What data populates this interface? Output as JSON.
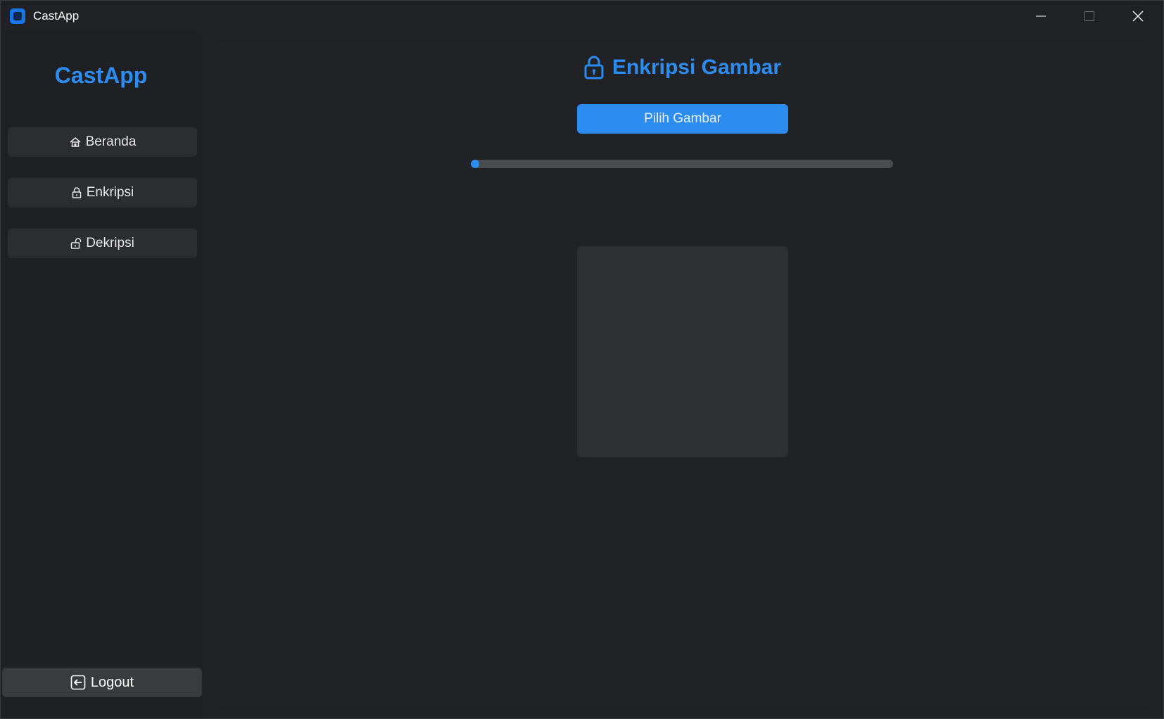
{
  "window": {
    "title": "CastApp"
  },
  "sidebar": {
    "brand": "CastApp",
    "items": [
      {
        "label": "Beranda",
        "icon": "home-icon"
      },
      {
        "label": "Enkripsi",
        "icon": "lock-icon"
      },
      {
        "label": "Dekripsi",
        "icon": "unlock-icon"
      }
    ],
    "logout_label": "Logout"
  },
  "main": {
    "title": "Enkripsi Gambar",
    "title_icon": "lock-icon",
    "pick_button_label": "Pilih Gambar",
    "progress": 0.0
  },
  "colors": {
    "accent": "#2d8cf0",
    "background": "#202124",
    "button_bg": "#2c2d30"
  }
}
